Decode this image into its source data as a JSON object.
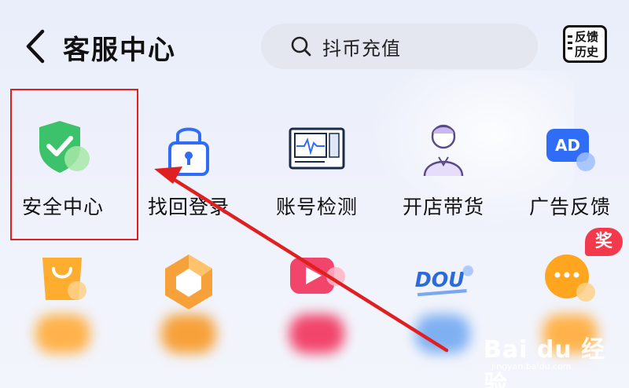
{
  "header": {
    "title": "客服中心",
    "search_placeholder": "抖币充值",
    "feedback_line1": "反馈",
    "feedback_line2": "历史"
  },
  "grid_row1": [
    {
      "label": "安全中心",
      "icon": "shield-check-icon"
    },
    {
      "label": "找回登录",
      "icon": "lock-icon"
    },
    {
      "label": "账号检测",
      "icon": "monitor-icon"
    },
    {
      "label": "开店带货",
      "icon": "shop-assistant-icon"
    },
    {
      "label": "广告反馈",
      "icon": "ad-icon"
    }
  ],
  "grid_row2_icons": [
    "shopping-bag-icon",
    "hexagon-icon",
    "video-play-icon",
    "dou-logo-icon",
    "chat-bubble-icon"
  ],
  "badge": {
    "text": "奖"
  },
  "watermark": {
    "brand": "Bai du 经验",
    "url": "jingyan.baidu.com"
  },
  "colors": {
    "highlight": "#e02020",
    "arrow": "#e02020",
    "accent_blue": "#2f6df6",
    "green": "#3cc26a"
  }
}
